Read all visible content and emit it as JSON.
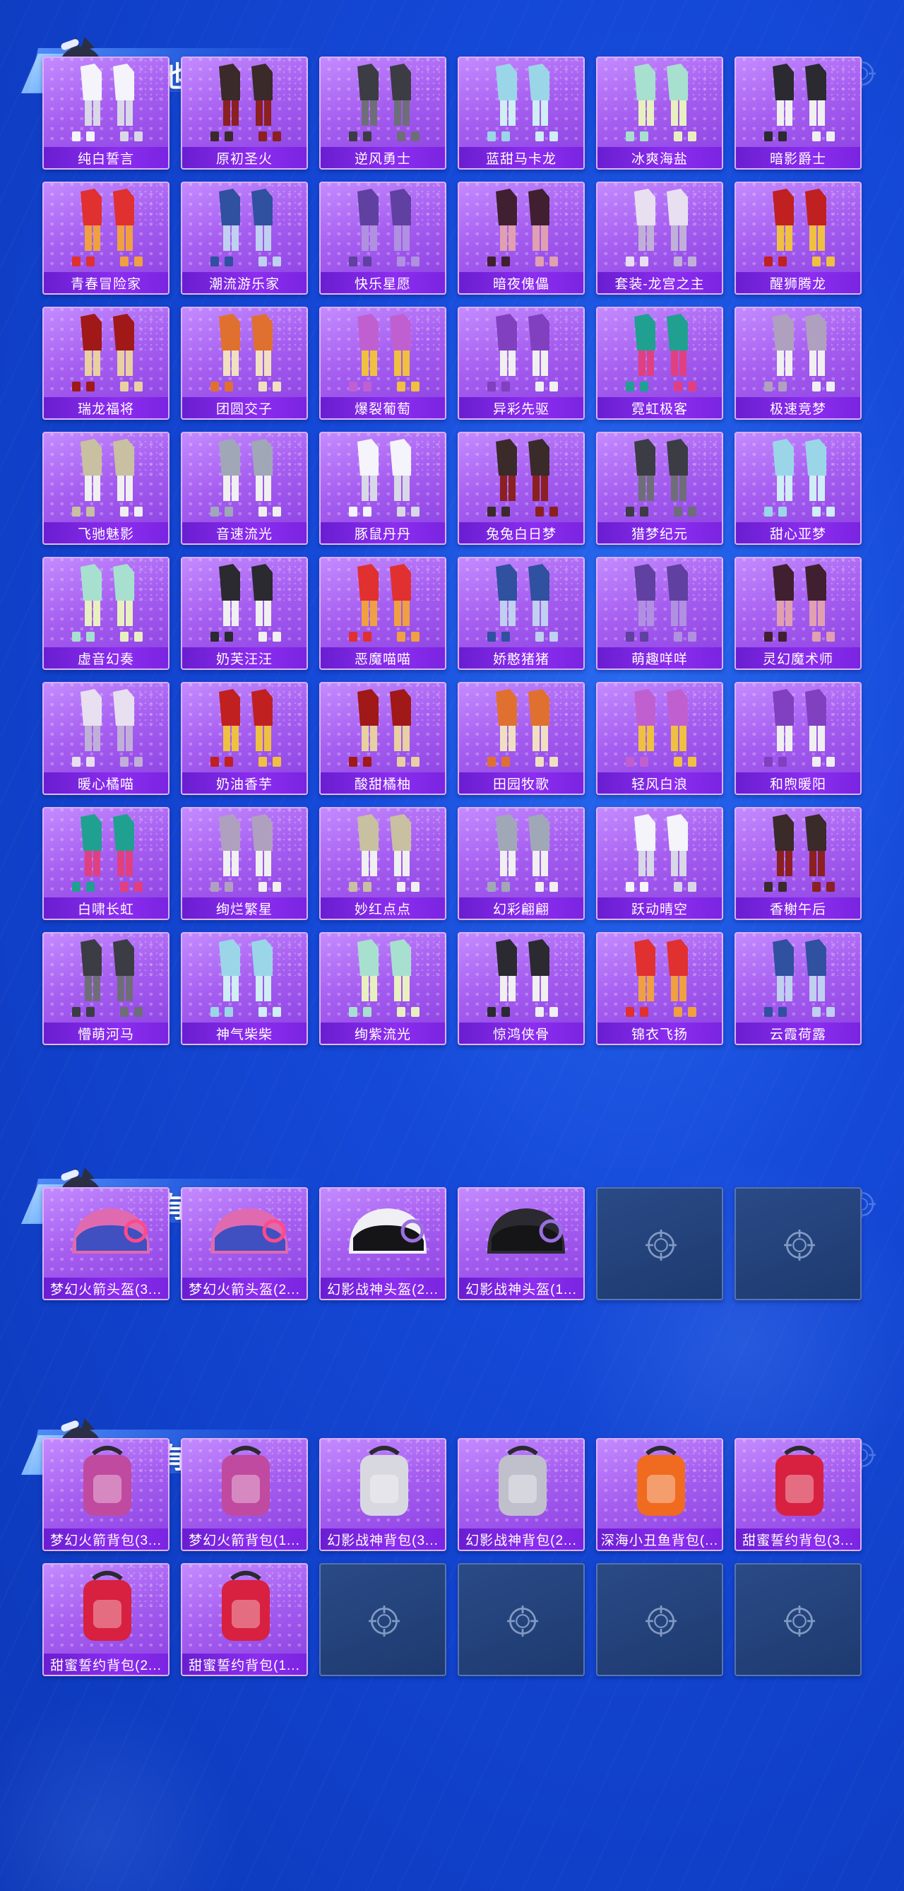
{
  "sections": [
    {
      "title": "其他套装",
      "items": [
        "纯白誓言",
        "原初圣火",
        "逆风勇士",
        "蓝甜马卡龙",
        "冰爽海盐",
        "暗影爵士",
        "青春冒险家",
        "潮流游乐家",
        "快乐星愿",
        "暗夜傀儡",
        "套装-龙宫之主",
        "醒狮腾龙",
        "瑞龙福将",
        "团圆交子",
        "爆裂葡萄",
        "异彩先驱",
        "霓虹极客",
        "极速竞梦",
        "飞驰魅影",
        "音速流光",
        "豚鼠丹丹",
        "兔兔白日梦",
        "猎梦纪元",
        "甜心亚梦",
        "虚音幻奏",
        "奶芙汪汪",
        "恶魔喵喵",
        "娇憨猪猪",
        "萌趣咩咩",
        "灵幻魔术师",
        "暖心橘喵",
        "奶油香芋",
        "酸甜橘柚",
        "田园牧歌",
        "轻风白浪",
        "和煦暖阳",
        "白啸长虹",
        "绚烂繁星",
        "妙红点点",
        "幻彩翩翩",
        "跃动晴空",
        "香榭午后",
        "懵萌河马",
        "神气柴柴",
        "绚紫流光",
        "惊鸿侠骨",
        "锦衣飞扬",
        "云霞荷露"
      ],
      "empty_slots": 0
    },
    {
      "title": "稀有头盔",
      "items": [
        "梦幻火箭头盔(3...",
        "梦幻火箭头盔(2...",
        "幻影战神头盔(2...",
        "幻影战神头盔(1..."
      ],
      "empty_slots": 2
    },
    {
      "title": "稀有背包",
      "items": [
        "梦幻火箭背包(3...",
        "梦幻火箭背包(1...",
        "幻影战神背包(3...",
        "幻影战神背包(2...",
        "深海小丑鱼背包(...",
        "甜蜜誓约背包(3...",
        "甜蜜誓约背包(2...",
        "甜蜜誓约背包(1..."
      ],
      "empty_slots": 4
    }
  ],
  "icons": {
    "header_reticle": "crosshair-icon",
    "empty_slot": "crosshair-icon",
    "mascot": "mascot-icon"
  },
  "colors": {
    "background": "#1549d8",
    "card_purple": "#a65ef0",
    "label_bar": "#7a24e0",
    "empty_slot": "#1e3a70"
  }
}
